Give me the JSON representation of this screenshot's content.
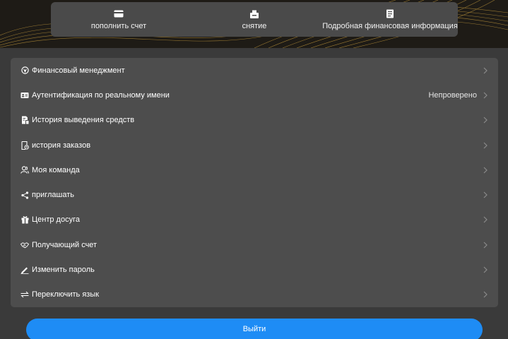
{
  "actions": [
    {
      "icon": "card-icon",
      "label": "пополнить счет"
    },
    {
      "icon": "wallet-icon",
      "label": "снятие"
    },
    {
      "icon": "document-icon",
      "label": "Подробная финансовая информация"
    }
  ],
  "menu": [
    {
      "icon": "finance-icon",
      "label": "Финансовый менеджмент",
      "status": ""
    },
    {
      "icon": "id-card-icon",
      "label": "Аутентификация по реальному имени",
      "status": "Непроверено"
    },
    {
      "icon": "withdraw-history-icon",
      "label": "История выведения средств",
      "status": ""
    },
    {
      "icon": "order-history-icon",
      "label": "история заказов",
      "status": ""
    },
    {
      "icon": "team-icon",
      "label": "Моя команда",
      "status": ""
    },
    {
      "icon": "share-icon",
      "label": "приглашать",
      "status": ""
    },
    {
      "icon": "gift-icon",
      "label": "Центр досуга",
      "status": ""
    },
    {
      "icon": "handshake-icon",
      "label": "Получающий счет",
      "status": ""
    },
    {
      "icon": "pen-icon",
      "label": "Изменить пароль",
      "status": ""
    },
    {
      "icon": "switch-icon",
      "label": "Переключить язык",
      "status": ""
    }
  ],
  "logout_label": "Выйти",
  "colors": {
    "background": "#3a3a3a",
    "panel": "#4d4d4d",
    "action_bar": "#4a4a4a",
    "accent": "#1e8cf5",
    "hero_gold": "#b8913a"
  }
}
